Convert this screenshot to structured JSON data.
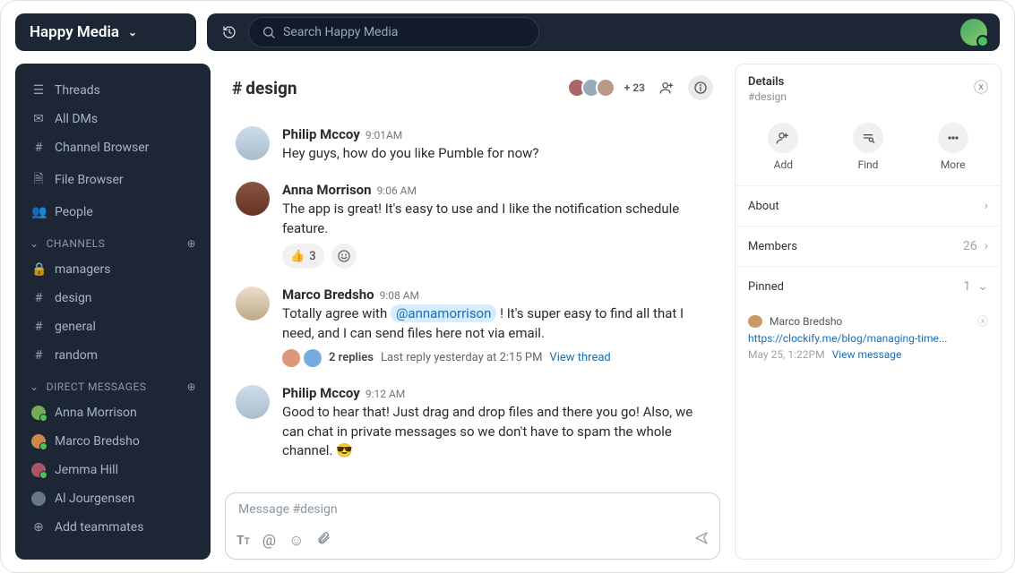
{
  "workspace": {
    "name": "Happy Media"
  },
  "search": {
    "placeholder": "Search Happy Media"
  },
  "sidebar": {
    "top": [
      {
        "label": "Threads"
      },
      {
        "label": "All DMs"
      },
      {
        "label": "Channel Browser"
      },
      {
        "label": "File Browser"
      },
      {
        "label": "People"
      }
    ],
    "channels_header": "CHANNELS",
    "channels": [
      {
        "label": "managers",
        "locked": true
      },
      {
        "label": "design"
      },
      {
        "label": "general"
      },
      {
        "label": "random"
      }
    ],
    "dms_header": "DIRECT MESSAGES",
    "dms": [
      {
        "label": "Anna Morrison"
      },
      {
        "label": "Marco Bredsho"
      },
      {
        "label": "Jemma Hill"
      },
      {
        "label": "Al Jourgensen"
      }
    ],
    "add_teammates": "Add teammates"
  },
  "channel": {
    "name": "design",
    "more_members": "+ 23"
  },
  "messages": [
    {
      "author": "Philip Mccoy",
      "time": "9:01AM",
      "body": "Hey guys, how do you like Pumble for now?"
    },
    {
      "author": "Anna Morrison",
      "time": "9:06 AM",
      "body": "The app is great! It's easy to use and I like the notification schedule feature.",
      "reaction_count": "3"
    },
    {
      "author": "Marco Bredsho",
      "time": "9:08 AM",
      "body_pre": "Totally agree with ",
      "mention": "@annamorrison",
      "body_post": " ! It's super easy to find all that I need, and I can send files here not via email.",
      "replies": "2 replies",
      "last_reply": "Last reply yesterday at 2:15 PM",
      "view_thread": "View thread"
    },
    {
      "author": "Philip Mccoy",
      "time": "9:12 AM",
      "body": "Good to hear that! Just drag and drop files and there you go! Also, we can chat in private messages so we don't have to spam the whole channel. 😎"
    }
  ],
  "composer": {
    "placeholder": "Message #design"
  },
  "details": {
    "title": "Details",
    "subtitle": "#design",
    "actions": {
      "add": "Add",
      "find": "Find",
      "more": "More"
    },
    "about": "About",
    "members": "Members",
    "members_count": "26",
    "pinned": "Pinned",
    "pinned_count": "1",
    "pinned_item": {
      "author": "Marco Bredsho",
      "link": "https://clockify.me/blog/managing-time...",
      "meta": "May 25, 1:22PM",
      "view": "View message"
    }
  }
}
